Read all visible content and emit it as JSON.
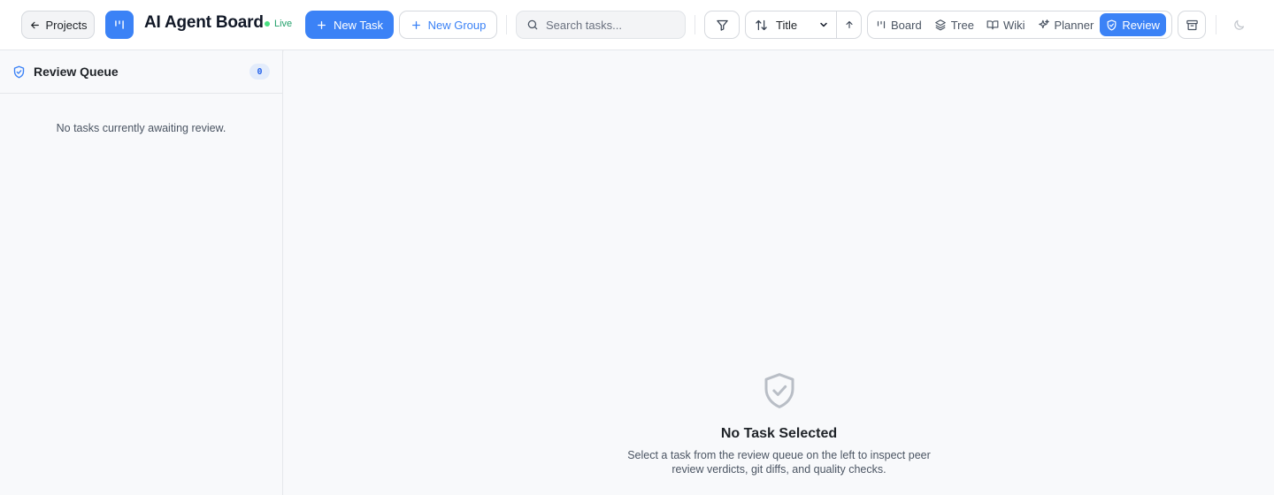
{
  "header": {
    "back_label": "Projects",
    "app_title": "AI Agent Board",
    "live_label": "Live",
    "new_task_label": "New Task",
    "new_group_label": "New Group",
    "search_placeholder": "Search tasks...",
    "sort_field": "Title",
    "view_tabs": [
      {
        "label": "Board",
        "icon": "kanban-icon",
        "active": false
      },
      {
        "label": "Tree",
        "icon": "layers-icon",
        "active": false
      },
      {
        "label": "Wiki",
        "icon": "book-open-icon",
        "active": false
      },
      {
        "label": "Planner",
        "icon": "sparkles-icon",
        "active": false
      },
      {
        "label": "Review",
        "icon": "shield-check-icon",
        "active": true
      }
    ]
  },
  "sidebar": {
    "title": "Review Queue",
    "count": "0",
    "empty_message": "No tasks currently awaiting review."
  },
  "main": {
    "empty_title": "No Task Selected",
    "empty_description": "Select a task from the review queue on the left to inspect peer review verdicts, git diffs, and quality checks."
  },
  "colors": {
    "accent": "#3b82f6",
    "live": "#22a06b",
    "background": "#f8f9fb",
    "border": "#e5e7eb"
  }
}
